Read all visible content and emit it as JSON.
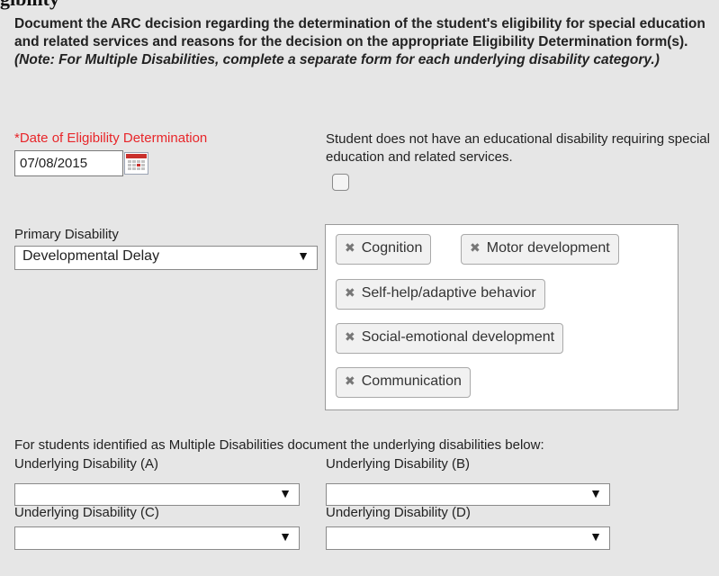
{
  "header": {
    "title": "gibility"
  },
  "instructions": {
    "text": "Document the ARC decision regarding the determination of the student's eligibility for special education and related services and reasons for the decision on the appropriate Eligibility Determination form(s). ",
    "note": "(Note: For Multiple Disabilities, complete a separate form for each underlying disability category.)"
  },
  "eligibility_date": {
    "label": "*Date of Eligibility Determination",
    "value": "07/08/2015"
  },
  "no_disability": {
    "text": "Student does not have an educational disability requiring special education and related services.",
    "checked": false
  },
  "primary_disability": {
    "label": "Primary Disability",
    "selected": "Developmental Delay",
    "tags": [
      "Cognition",
      "Motor development",
      "Self-help/adaptive behavior",
      "Social-emotional development",
      "Communication"
    ]
  },
  "multiple": {
    "intro": "For students identified as Multiple Disabilities document the underlying disabilities below:",
    "underlying": [
      {
        "label": "Underlying Disability (A)",
        "selected": ""
      },
      {
        "label": "Underlying Disability (B)",
        "selected": ""
      },
      {
        "label": "Underlying Disability (C)",
        "selected": ""
      },
      {
        "label": "Underlying Disability (D)",
        "selected": ""
      }
    ]
  },
  "icons": {
    "calendar": "calendar-icon",
    "dropdown": "chevron-down-icon",
    "tag_remove": "close-icon",
    "dropdown_glyph": "▼",
    "remove_glyph": "✖"
  },
  "colors": {
    "required_label": "#e8262a",
    "background": "#e6e6e6"
  }
}
